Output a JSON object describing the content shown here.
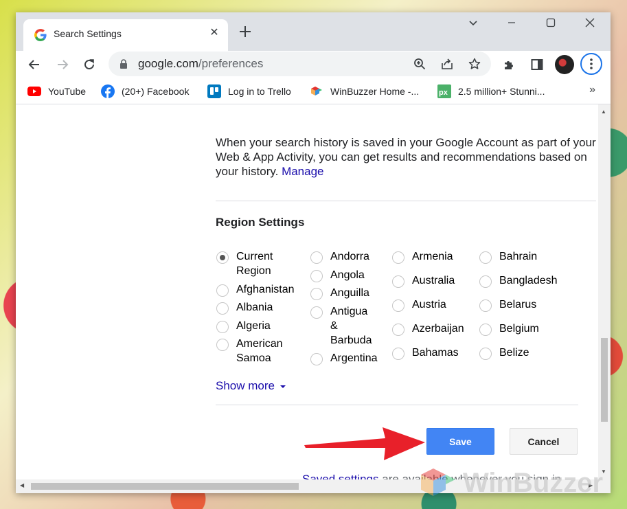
{
  "tab": {
    "title": "Search Settings",
    "close": "✕"
  },
  "window_controls": {
    "dropdown": "⌄",
    "minimize": "—",
    "maximize": "☐",
    "close": "✕"
  },
  "address_bar": {
    "url_host": "google.com",
    "url_path": "/preferences"
  },
  "bookmarks": [
    {
      "label": "YouTube",
      "icon": "youtube-icon"
    },
    {
      "label": "(20+) Facebook",
      "icon": "facebook-icon"
    },
    {
      "label": "Log in to Trello",
      "icon": "trello-icon"
    },
    {
      "label": "WinBuzzer Home -...",
      "icon": "winbuzzer-icon"
    },
    {
      "label": "2.5 million+ Stunni...",
      "icon": "pixabay-icon"
    }
  ],
  "bookmarks_more": "»",
  "history": {
    "text": "When your search history is saved in your Google Account as part of your Web & App Activity, you can get results and recommendations based on your history.",
    "link": "Manage"
  },
  "region": {
    "title": "Region Settings",
    "columns": [
      [
        "Current Region",
        "Afghanistan",
        "Albania",
        "Algeria",
        "American Samoa"
      ],
      [
        "Andorra",
        "Angola",
        "Anguilla",
        "Antigua & Barbuda",
        "Argentina"
      ],
      [
        "Armenia",
        "Australia",
        "Austria",
        "Azerbaijan",
        "Bahamas"
      ],
      [
        "Bahrain",
        "Bangladesh",
        "Belarus",
        "Belgium",
        "Belize"
      ]
    ],
    "selected": "Current Region",
    "show_more": "Show more"
  },
  "buttons": {
    "save": "Save",
    "cancel": "Cancel"
  },
  "saved_note": {
    "link": "Saved settings",
    "rest": " are available whenever you sign in."
  },
  "watermark": "WinBuzzer",
  "colors": {
    "save_button": "#4285f4",
    "link": "#1a0dab",
    "arrow": "#e8202a"
  }
}
